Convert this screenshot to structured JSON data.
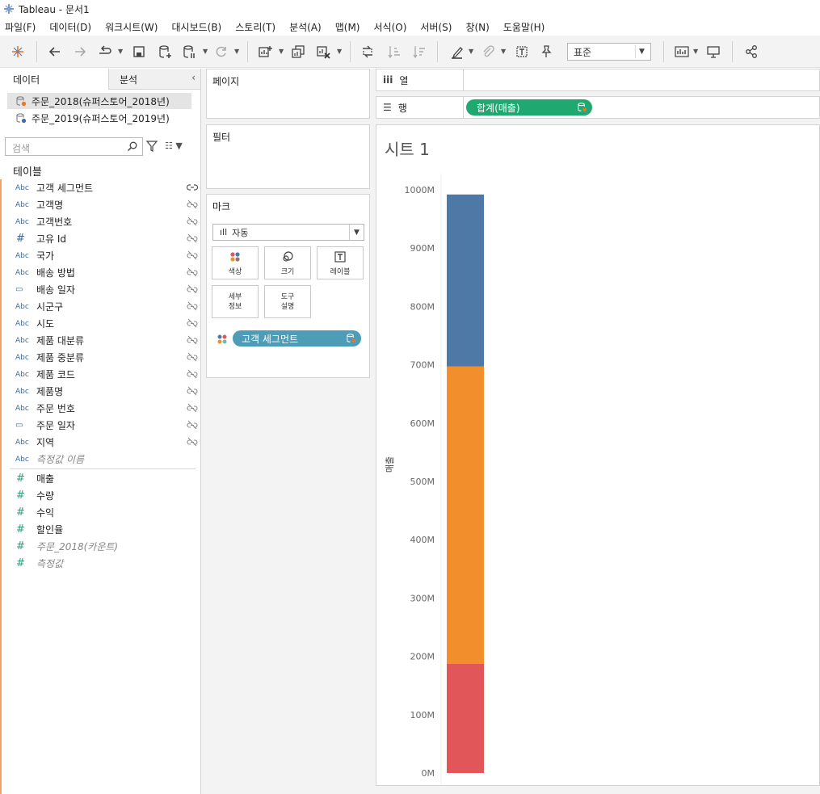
{
  "window": {
    "title": "Tableau - 문서1"
  },
  "menu": [
    "파일(F)",
    "데이터(D)",
    "워크시트(W)",
    "대시보드(B)",
    "스토리(T)",
    "분석(A)",
    "맵(M)",
    "서식(O)",
    "서버(S)",
    "창(N)",
    "도움말(H)"
  ],
  "toolbar": {
    "fit_value": "표준"
  },
  "data_pane": {
    "tab_data": "데이터",
    "tab_analysis": "분석",
    "datasources": [
      "주문_2018(슈퍼스토어_2018년)",
      "주문_2019(슈퍼스토어_2019년)"
    ],
    "search_placeholder": "검색",
    "tables_label": "테이블",
    "dimensions": [
      {
        "type": "Abc",
        "name": "고객 세그먼트"
      },
      {
        "type": "Abc",
        "name": "고객명"
      },
      {
        "type": "Abc",
        "name": "고객번호"
      },
      {
        "type": "#",
        "name": "고유 Id"
      },
      {
        "type": "Abc",
        "name": "국가"
      },
      {
        "type": "Abc",
        "name": "배송 방법"
      },
      {
        "type": "date",
        "name": "배송 일자"
      },
      {
        "type": "Abc",
        "name": "시군구"
      },
      {
        "type": "Abc",
        "name": "시도"
      },
      {
        "type": "Abc",
        "name": "제품 대분류"
      },
      {
        "type": "Abc",
        "name": "제품 중분류"
      },
      {
        "type": "Abc",
        "name": "제품 코드"
      },
      {
        "type": "Abc",
        "name": "제품명"
      },
      {
        "type": "Abc",
        "name": "주문 번호"
      },
      {
        "type": "date",
        "name": "주문 일자"
      },
      {
        "type": "Abc",
        "name": "지역"
      },
      {
        "type": "Abc",
        "name": "측정값 이름",
        "italic": true
      }
    ],
    "measures": [
      {
        "type": "#",
        "name": "매출"
      },
      {
        "type": "#",
        "name": "수량"
      },
      {
        "type": "#",
        "name": "수익"
      },
      {
        "type": "#",
        "name": "할인율"
      },
      {
        "type": "#",
        "name": "주문_2018(카운트)",
        "italic": true
      },
      {
        "type": "#",
        "name": "측정값",
        "italic": true
      }
    ]
  },
  "cards": {
    "pages": "페이지",
    "filters": "필터",
    "marks": "마크",
    "marks_type": "자동",
    "buttons": {
      "color": "색상",
      "size": "크기",
      "label": "레이블",
      "detail": "세부\n정보",
      "tooltip": "도구\n설명"
    },
    "marks_pill": "고객 세그먼트"
  },
  "shelves": {
    "columns_label": "열",
    "rows_label": "행",
    "rows_pill": "합계(매출)"
  },
  "sheet": {
    "title": "시트 1"
  },
  "chart_data": {
    "type": "bar",
    "stacked": true,
    "categories": [
      ""
    ],
    "series": [
      {
        "name": "",
        "color": "#e15759",
        "values": [
          187
        ]
      },
      {
        "name": "",
        "color": "#f28e2b",
        "values": [
          510
        ]
      },
      {
        "name": "",
        "color": "#4e79a7",
        "values": [
          295
        ]
      }
    ],
    "units": "M",
    "ylabel": "매출",
    "ylim": [
      0,
      1000
    ],
    "yticks": [
      0,
      100,
      200,
      300,
      400,
      500,
      600,
      700,
      800,
      900,
      1000
    ],
    "grid": false,
    "legend": "none"
  }
}
